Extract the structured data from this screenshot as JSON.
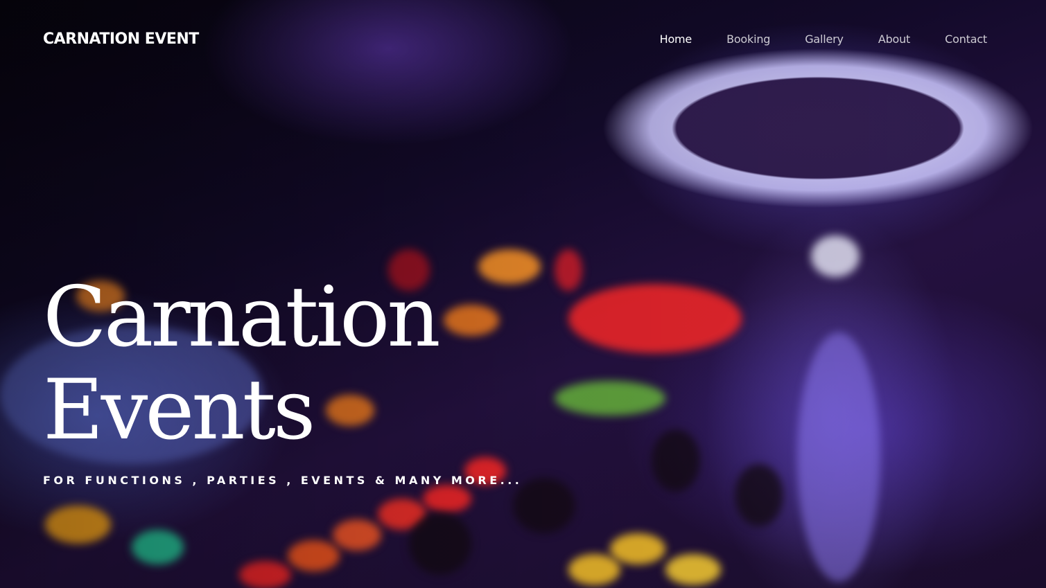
{
  "brand": {
    "name": "CARNATION EVENT"
  },
  "nav": {
    "items": [
      {
        "label": "Home",
        "active": true
      },
      {
        "label": "Booking",
        "active": false
      },
      {
        "label": "Gallery",
        "active": false
      },
      {
        "label": "About",
        "active": false
      },
      {
        "label": "Contact",
        "active": false
      }
    ]
  },
  "hero": {
    "title_line1": "Carnation",
    "title_line2": "Events",
    "tagline": "FOR FUNCTIONS , PARTIES , EVENTS & MANY MORE..."
  },
  "background": {
    "image_subject": "blurred DJ mixer console with glowing knobs and turntable",
    "dominant_colors": [
      "#130a2a",
      "#6c5ce7",
      "#ff3b2f",
      "#ff9a1f",
      "#e9e6ff"
    ]
  }
}
